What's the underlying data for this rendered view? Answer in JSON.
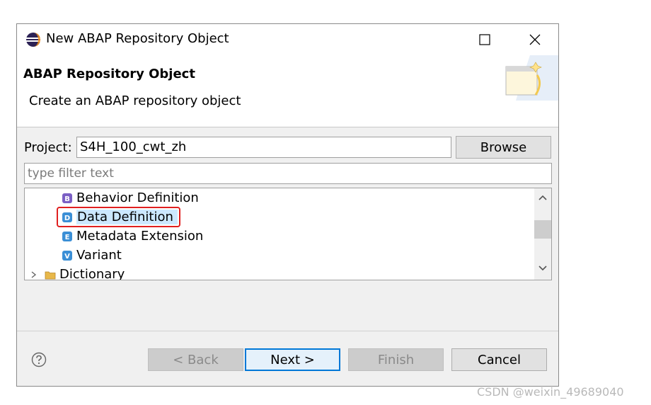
{
  "window": {
    "title": "New ABAP Repository Object",
    "icon": "eclipse-icon"
  },
  "header": {
    "title": "ABAP Repository Object",
    "description": "Create an ABAP repository object"
  },
  "project": {
    "label": "Project:",
    "value": "S4H_100_cwt_zh",
    "browse_label": "Browse"
  },
  "filter": {
    "placeholder": "type filter text",
    "value": ""
  },
  "tree": {
    "items": [
      {
        "label": "Behavior Definition",
        "icon": "behavior-definition-icon",
        "icon_letter": "B",
        "selected": false
      },
      {
        "label": "Data Definition",
        "icon": "data-definition-icon",
        "icon_letter": "D",
        "selected": true
      },
      {
        "label": "Metadata Extension",
        "icon": "metadata-extension-icon",
        "icon_letter": "E",
        "selected": false
      },
      {
        "label": "Variant",
        "icon": "variant-icon",
        "icon_letter": "V",
        "selected": false
      },
      {
        "label": "Dictionary",
        "icon": "folder-icon",
        "selected": false,
        "expandable": true
      }
    ]
  },
  "buttons": {
    "back": "< Back",
    "next": "Next >",
    "finish": "Finish",
    "cancel": "Cancel"
  },
  "watermark": "CSDN @weixin_49689040",
  "colors": {
    "selection": "#cce8ff",
    "highlight_box": "#e02020",
    "default_button_border": "#0078d7"
  }
}
